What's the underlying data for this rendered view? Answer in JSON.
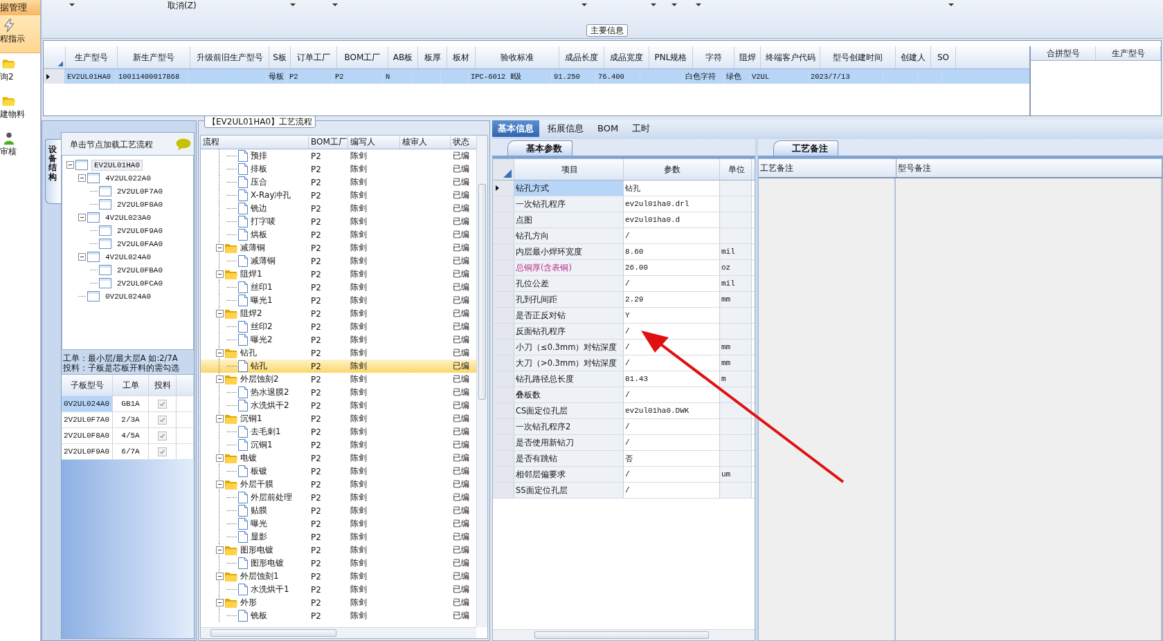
{
  "nav": {
    "header": "据管理",
    "items": [
      {
        "label": "程指示",
        "selected": true
      },
      {
        "label": "询2",
        "selected": false
      },
      {
        "label": "建物料",
        "selected": false
      },
      {
        "label": "审核",
        "selected": false
      }
    ]
  },
  "toolbar": {
    "cancel_label": "取消(Z)"
  },
  "main_info": {
    "title": "主要信息",
    "columns": [
      "生产型号",
      "新生产型号",
      "升级前旧生产型号",
      "S板",
      "订单工厂",
      "BOM工厂",
      "AB板",
      "板厚",
      "板材",
      "验收标准",
      "成品长度",
      "成品宽度",
      "PNL规格",
      "字符",
      "阻焊",
      "终端客户代码",
      "型号创建时间",
      "创建人",
      "SO"
    ],
    "rows": [
      {
        "selected": true,
        "cells": [
          "EV2UL01HA0",
          "10011400017868",
          "",
          "母板",
          "P2",
          "P2",
          "N",
          "",
          "",
          "IPC-6012 Ⅱ级",
          "91.250",
          "76.400",
          "",
          "白色字符",
          "绿色",
          "V2UL",
          "2023/7/13",
          "",
          ""
        ]
      }
    ],
    "side_columns": [
      "合拼型号",
      "生产型号"
    ]
  },
  "device": {
    "tab": "设备结构",
    "hint": "单击节点加载工艺流程",
    "tree": [
      {
        "label": "EV2UL01HA0",
        "selected": true,
        "expanded": true,
        "children": [
          {
            "label": "4V2UL022A0",
            "selected": false,
            "expanded": true,
            "children": [
              {
                "label": "2V2UL0F7A0",
                "selected": false
              },
              {
                "label": "2V2UL0F8A0",
                "selected": false
              }
            ]
          },
          {
            "label": "4V2UL023A0",
            "selected": false,
            "expanded": true,
            "children": [
              {
                "label": "2V2UL0F9A0",
                "selected": false
              },
              {
                "label": "2V2UL0FAA0",
                "selected": false
              }
            ]
          },
          {
            "label": "4V2UL024A0",
            "selected": false,
            "expanded": true,
            "children": [
              {
                "label": "2V2UL0FBA0",
                "selected": false
              },
              {
                "label": "2V2UL0FCA0",
                "selected": false
              }
            ]
          },
          {
            "label": "0V2UL024A0",
            "selected": false
          }
        ]
      }
    ],
    "notes": [
      "工单：最小层/最大层A 如:2/7A",
      "投料：子板是芯板开料的需勾选"
    ],
    "sub_columns": [
      "子板型号",
      "工单",
      "投料"
    ],
    "sub_rows": [
      {
        "model": "0V2UL024A0",
        "order": "GB1A",
        "checked": true,
        "selected": true
      },
      {
        "model": "2V2UL0F7A0",
        "order": "2/3A",
        "checked": true,
        "selected": false
      },
      {
        "model": "2V2UL0F8A0",
        "order": "4/5A",
        "checked": true,
        "selected": false
      },
      {
        "model": "2V2UL0F9A0",
        "order": "6/7A",
        "checked": true,
        "selected": false
      }
    ]
  },
  "flow": {
    "title": "【EV2UL01HA0】工艺流程",
    "columns": [
      "流程",
      "BOM工厂",
      "编写人",
      "核审人",
      "状态"
    ],
    "leading_children": [
      {
        "name": "预排",
        "bom_factory": "P2",
        "author": "陈剑",
        "status": "已编",
        "selected": false
      },
      {
        "name": "排板",
        "bom_factory": "P2",
        "author": "陈剑",
        "status": "已编",
        "selected": false
      },
      {
        "name": "压合",
        "bom_factory": "P2",
        "author": "陈剑",
        "status": "已编",
        "selected": false
      },
      {
        "name": "X-Ray冲孔",
        "bom_factory": "P2",
        "author": "陈剑",
        "status": "已编",
        "selected": false
      },
      {
        "name": "铣边",
        "bom_factory": "P2",
        "author": "陈剑",
        "status": "已编",
        "selected": false
      },
      {
        "name": "打字唛",
        "bom_factory": "P2",
        "author": "陈剑",
        "status": "已编",
        "selected": false
      },
      {
        "name": "烘板",
        "bom_factory": "P2",
        "author": "陈剑",
        "status": "已编",
        "selected": false
      }
    ],
    "groups": [
      {
        "name": "减薄铜",
        "bom_factory": "P2",
        "author": "陈剑",
        "status": "已编",
        "selected": false,
        "expanded": true,
        "children": [
          {
            "name": "减薄铜",
            "bom_factory": "P2",
            "author": "陈剑",
            "status": "已编",
            "selected": false
          }
        ]
      },
      {
        "name": "阻焊1",
        "bom_factory": "P2",
        "author": "陈剑",
        "status": "已编",
        "selected": false,
        "expanded": true,
        "children": [
          {
            "name": "丝印1",
            "bom_factory": "P2",
            "author": "陈剑",
            "status": "已编",
            "selected": false
          },
          {
            "name": "曝光1",
            "bom_factory": "P2",
            "author": "陈剑",
            "status": "已编",
            "selected": false
          }
        ]
      },
      {
        "name": "阻焊2",
        "bom_factory": "P2",
        "author": "陈剑",
        "status": "已编",
        "selected": false,
        "expanded": true,
        "children": [
          {
            "name": "丝印2",
            "bom_factory": "P2",
            "author": "陈剑",
            "status": "已编",
            "selected": false
          },
          {
            "name": "曝光2",
            "bom_factory": "P2",
            "author": "陈剑",
            "status": "已编",
            "selected": false
          }
        ]
      },
      {
        "name": "钻孔",
        "bom_factory": "P2",
        "author": "陈剑",
        "status": "已编",
        "selected": false,
        "expanded": true,
        "children": [
          {
            "name": "钻孔",
            "bom_factory": "P2",
            "author": "陈剑",
            "status": "已编",
            "selected": true
          }
        ]
      },
      {
        "name": "外层蚀刻2",
        "bom_factory": "P2",
        "author": "陈剑",
        "status": "已编",
        "selected": false,
        "expanded": true,
        "children": [
          {
            "name": "热水退膜2",
            "bom_factory": "P2",
            "author": "陈剑",
            "status": "已编",
            "selected": false
          },
          {
            "name": "水洗烘干2",
            "bom_factory": "P2",
            "author": "陈剑",
            "status": "已编",
            "selected": false
          }
        ]
      },
      {
        "name": "沉铜1",
        "bom_factory": "P2",
        "author": "陈剑",
        "status": "已编",
        "selected": false,
        "expanded": true,
        "children": [
          {
            "name": "去毛刺1",
            "bom_factory": "P2",
            "author": "陈剑",
            "status": "已编",
            "selected": false
          },
          {
            "name": "沉铜1",
            "bom_factory": "P2",
            "author": "陈剑",
            "status": "已编",
            "selected": false
          }
        ]
      },
      {
        "name": "电镀",
        "bom_factory": "P2",
        "author": "陈剑",
        "status": "已编",
        "selected": false,
        "expanded": true,
        "children": [
          {
            "name": "板镀",
            "bom_factory": "P2",
            "author": "陈剑",
            "status": "已编",
            "selected": false
          }
        ]
      },
      {
        "name": "外层干膜",
        "bom_factory": "P2",
        "author": "陈剑",
        "status": "已编",
        "selected": false,
        "expanded": true,
        "children": [
          {
            "name": "外层前处理",
            "bom_factory": "P2",
            "author": "陈剑",
            "status": "已编",
            "selected": false
          },
          {
            "name": "贴膜",
            "bom_factory": "P2",
            "author": "陈剑",
            "status": "已编",
            "selected": false
          },
          {
            "name": "曝光",
            "bom_factory": "P2",
            "author": "陈剑",
            "status": "已编",
            "selected": false
          },
          {
            "name": "显影",
            "bom_factory": "P2",
            "author": "陈剑",
            "status": "已编",
            "selected": false
          }
        ]
      },
      {
        "name": "图形电镀",
        "bom_factory": "P2",
        "author": "陈剑",
        "status": "已编",
        "selected": false,
        "expanded": true,
        "children": [
          {
            "name": "图形电镀",
            "bom_factory": "P2",
            "author": "陈剑",
            "status": "已编",
            "selected": false
          }
        ]
      },
      {
        "name": "外层蚀刻1",
        "bom_factory": "P2",
        "author": "陈剑",
        "status": "已编",
        "selected": false,
        "expanded": true,
        "children": [
          {
            "name": "水洗烘干1",
            "bom_factory": "P2",
            "author": "陈剑",
            "status": "已编",
            "selected": false
          }
        ]
      },
      {
        "name": "外形",
        "bom_factory": "P2",
        "author": "陈剑",
        "status": "已编",
        "selected": false,
        "expanded": true,
        "children": [
          {
            "name": "铣板",
            "bom_factory": "P2",
            "author": "陈剑",
            "status": "已编",
            "selected": false
          }
        ]
      }
    ]
  },
  "detail_tabs": [
    {
      "label": "基本信息",
      "selected": true
    },
    {
      "label": "拓展信息",
      "selected": false
    },
    {
      "label": "BOM",
      "selected": false
    },
    {
      "label": "工时",
      "selected": false
    }
  ],
  "params": {
    "tab": "基本参数",
    "columns": [
      "项目",
      "参数",
      "单位"
    ],
    "rows": [
      {
        "item": "钻孔方式",
        "value": "钻孔",
        "unit": "",
        "selected": true,
        "emphasized": false
      },
      {
        "item": "一次钻孔程序",
        "value": "ev2ul01ha0.drl",
        "unit": "",
        "selected": false,
        "emphasized": false
      },
      {
        "item": "点图",
        "value": "ev2ul01ha0.d",
        "unit": "",
        "selected": false,
        "emphasized": false
      },
      {
        "item": "钻孔方向",
        "value": "/",
        "unit": "",
        "selected": false,
        "emphasized": false
      },
      {
        "item": "内层最小焊环宽度",
        "value": "8.60",
        "unit": "mil",
        "selected": false,
        "emphasized": false
      },
      {
        "item": "总铜厚(含表铜)",
        "value": "26.00",
        "unit": "oz",
        "selected": false,
        "emphasized": true
      },
      {
        "item": "孔位公差",
        "value": "/",
        "unit": "mil",
        "selected": false,
        "emphasized": false
      },
      {
        "item": "孔到孔间距",
        "value": "2.29",
        "unit": "mm",
        "selected": false,
        "emphasized": false
      },
      {
        "item": "是否正反对钻",
        "value": "Y",
        "unit": "",
        "selected": false,
        "emphasized": false
      },
      {
        "item": "反面钻孔程序",
        "value": "/",
        "unit": "",
        "selected": false,
        "emphasized": false
      },
      {
        "item": "小刀（≤0.3mm）对钻深度",
        "value": "/",
        "unit": "mm",
        "selected": false,
        "emphasized": false
      },
      {
        "item": "大刀（>0.3mm）对钻深度",
        "value": "/",
        "unit": "mm",
        "selected": false,
        "emphasized": false
      },
      {
        "item": "钻孔路径总长度",
        "value": "81.43",
        "unit": "m",
        "selected": false,
        "emphasized": false
      },
      {
        "item": "叠板数",
        "value": "/",
        "unit": "",
        "selected": false,
        "emphasized": false
      },
      {
        "item": "CS面定位孔层",
        "value": "ev2ul01ha0.DWK",
        "unit": "",
        "selected": false,
        "emphasized": false
      },
      {
        "item": "一次钻孔程序2",
        "value": "/",
        "unit": "",
        "selected": false,
        "emphasized": false
      },
      {
        "item": "是否使用新钻刀",
        "value": "/",
        "unit": "",
        "selected": false,
        "emphasized": false
      },
      {
        "item": "是否有跳钻",
        "value": "否",
        "unit": "",
        "selected": false,
        "emphasized": false
      },
      {
        "item": "相邻层偏要求",
        "value": "/",
        "unit": "um",
        "selected": false,
        "emphasized": false
      },
      {
        "item": "SS面定位孔层",
        "value": "/",
        "unit": "",
        "selected": false,
        "emphasized": false
      }
    ]
  },
  "remarks": {
    "tab": "工艺备注",
    "columns": [
      "工艺备注",
      "型号备注"
    ]
  }
}
